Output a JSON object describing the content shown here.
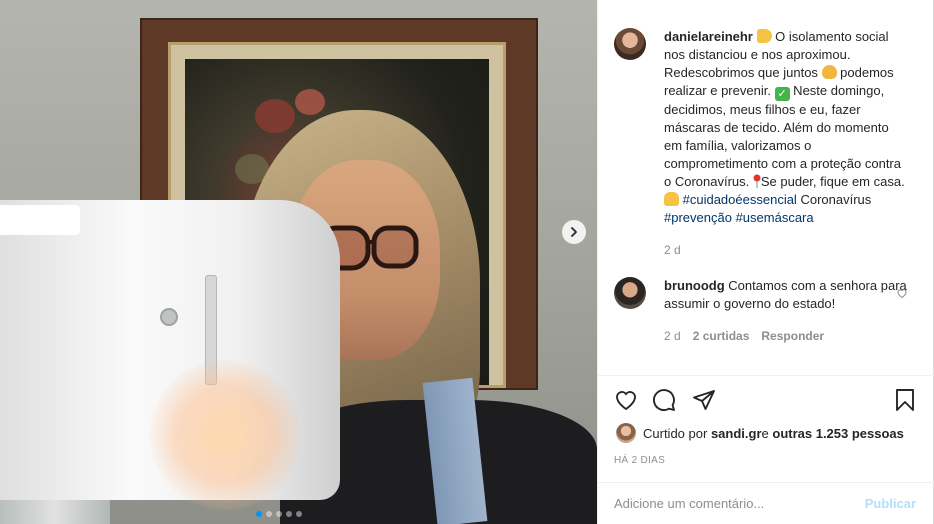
{
  "post": {
    "caption": {
      "username": "danielareinehr",
      "seg1": " O isolamento social nos distanciou e nos aproximou. Redescobrimos que juntos ",
      "seg2": " podemos realizar e prevenir. ",
      "seg3": " Neste domingo, decidimos, meus filhos e eu, fazer máscaras de tecido. Além do momento em família, valorizamos o comprometimento com a proteção contra o Coronavírus. ",
      "seg4": "Se puder, fique em casa.",
      "hashtag1": "#cuidadoéessencial",
      "seg5": "Coronavírus ",
      "hashtag2": "#prevenção",
      "hashtag3": "#usemáscara",
      "time": "2 d"
    },
    "reply": {
      "username": "brunoodg",
      "text": " Contamos com a senhora para assumir o governo do estado!",
      "time": "2 d",
      "likes": "2 curtidas",
      "reply_label": "Responder"
    },
    "likes": {
      "prefix": "Curtido por ",
      "liker": "sandi.gr",
      "joiner": " e ",
      "others": "outras 1.253 pessoas"
    },
    "date": "HÁ 2 DIAS",
    "add_comment": {
      "placeholder": "Adicione um comentário...",
      "post_label": "Publicar"
    }
  },
  "carousel": {
    "dots": 5,
    "active": 0
  },
  "icons": {
    "emoji1": "pointing-hand-icon",
    "emoji2": "heart-hands-icon",
    "emoji3": "check-mark-icon",
    "emoji4": "pin-icon",
    "emoji5": "thumbs-up-icon"
  },
  "colors": {
    "link": "#00376b",
    "muted": "#8e8e8e",
    "publish_disabled": "#b2dffc",
    "dot_active": "#0095f6"
  }
}
